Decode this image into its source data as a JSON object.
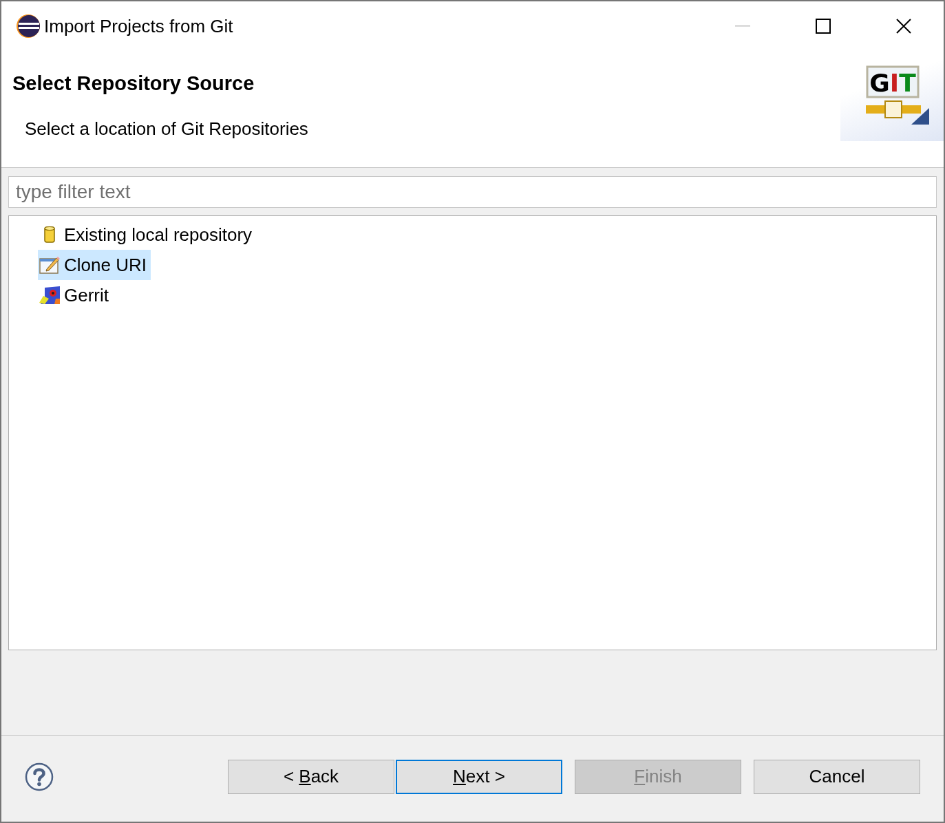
{
  "window": {
    "title": "Import Projects from Git"
  },
  "logo": {
    "letters": [
      {
        "text": "G",
        "color": "#000000"
      },
      {
        "text": "I",
        "color": "#c81e1e"
      },
      {
        "text": "T",
        "color": "#0a8a1a"
      }
    ]
  },
  "header": {
    "title": "Select Repository Source",
    "description": "Select a location of Git Repositories"
  },
  "filter": {
    "placeholder": "type filter text"
  },
  "tree": [
    {
      "label": "Existing local repository",
      "kind": "repository",
      "selected": false
    },
    {
      "label": "Clone URI",
      "kind": "clone",
      "selected": true
    },
    {
      "label": "Gerrit",
      "kind": "gerrit",
      "selected": false
    }
  ],
  "buttons": [
    {
      "before": "< ",
      "key": "B",
      "after": "ack",
      "default": false,
      "disabled": false
    },
    {
      "key": "N",
      "after": "ext >",
      "default": true,
      "disabled": false
    },
    {
      "key": "F",
      "after": "inish",
      "default": false,
      "disabled": true
    },
    {
      "before": "Cancel",
      "default": false,
      "disabled": false
    }
  ]
}
